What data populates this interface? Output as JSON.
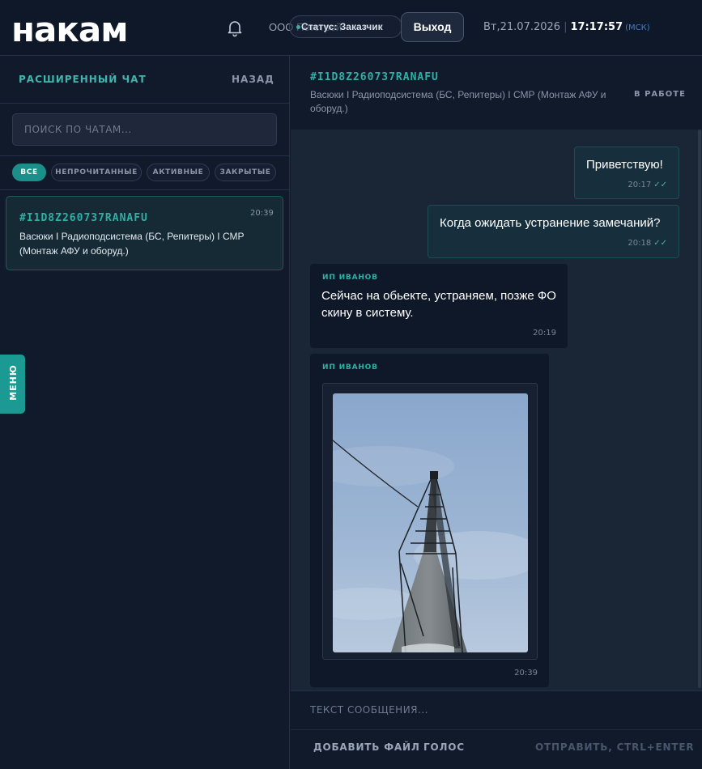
{
  "header": {
    "logo": "накам",
    "company": "ООО Петстрой",
    "status_label": "Статус: Заказчик",
    "logout_label": "Выход",
    "date": "Вт,21.07.2026",
    "time": "17:17:57",
    "timezone": "(МСК)"
  },
  "sidebar": {
    "title": "РАСШИРЕННЫЙ ЧАТ",
    "back_label": "НАЗАД",
    "search_placeholder": "ПОИСК ПО ЧАТАМ...",
    "filters": [
      {
        "label": "ВСЕ",
        "active": true
      },
      {
        "label": "НЕПРОЧИТАННЫЕ",
        "active": false
      },
      {
        "label": "АКТИВНЫЕ",
        "active": false
      },
      {
        "label": "ЗАКРЫТЫЕ",
        "active": false
      }
    ],
    "chats": [
      {
        "id": "#I1D8Z260737RANAFU",
        "time": "20:39",
        "description": "Васюки I Радиоподсистема (БС, Репитеры) I СМР (Монтаж АФУ и оборуд.)"
      }
    ],
    "menu_label": "МЕНЮ"
  },
  "chat": {
    "id": "#I1D8Z260737RANAFU",
    "description": "Васюки I Радиоподсистема (БС, Репитеры) I СМР (Монтаж АФУ и оборуд.)",
    "status": "В РАБОТЕ",
    "messages": [
      {
        "direction": "out",
        "text": "Приветствую!",
        "time": "20:17",
        "ticks": "✓✓"
      },
      {
        "direction": "out",
        "text": "Когда ожидать устранение замечаний?",
        "time": "20:18",
        "ticks": "✓✓"
      },
      {
        "direction": "in",
        "sender": "ИП ИВАНОВ",
        "text": "Сейчас на обьекте, устраняем, позже ФО скину в систему.",
        "time": "20:19"
      },
      {
        "direction": "in",
        "sender": "ИП ИВАНОВ",
        "attachment": "photo",
        "time": "20:39"
      }
    ]
  },
  "composer": {
    "placeholder": "ТЕКСТ СООБЩЕНИЯ...",
    "add_file_label": "ДОБАВИТЬ ФАЙЛ",
    "voice_label": "ГОЛОС",
    "send_label": "ОТПРАВИТЬ, CTRL+ENTER"
  },
  "colors": {
    "accent": "#1b8f89",
    "background": "#111a2b",
    "outgoing_bubble": "#172f3c",
    "incoming_bubble": "#0f1828"
  }
}
